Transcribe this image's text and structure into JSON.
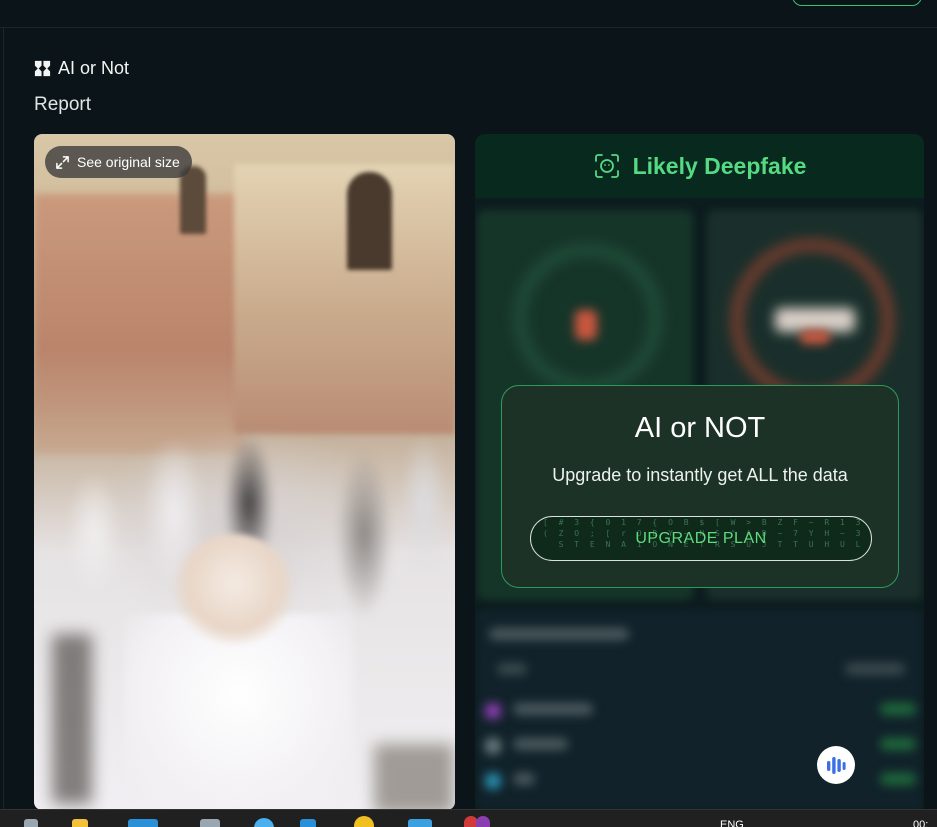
{
  "brand": {
    "name": "AI or Not",
    "logo_icon": "aiornot-logo-icon"
  },
  "page": {
    "title": "Report"
  },
  "media": {
    "see_original_label": "See original size",
    "expand_icon": "expand-icon"
  },
  "verdict": {
    "label": "Likely Deepfake",
    "icon": "face-scan-icon",
    "color": "#55d982"
  },
  "upsell": {
    "title": "AI or NOT",
    "subtitle": "Upgrade to instantly get ALL the data",
    "button_label": "UPGRADE PLAN",
    "noise_lines": [
      "[ # 3 { 0 1 7 { O B $ [ W > B Z F ~ R 1 3 X L F # K",
      "( Z O ; [ r O B Y ~ N S ^ A D ~ 7 Y H ~ 3 N L E r + Q /",
      "  S T E N A 1 O N E T R S U J T T U H U L E E G V H E"
    ]
  },
  "voice_button": {
    "icon": "audio-bars-icon"
  },
  "taskbar": {
    "language": "ENG",
    "clock": "00:"
  }
}
